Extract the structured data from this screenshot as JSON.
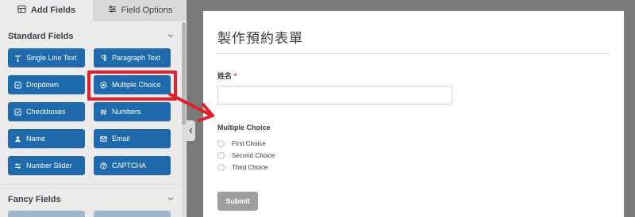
{
  "tabs": [
    {
      "label": "Add Fields",
      "icon": "list-icon",
      "active": true
    },
    {
      "label": "Field Options",
      "icon": "sliders-icon",
      "active": false
    }
  ],
  "sections": {
    "standard": {
      "title": "Standard Fields",
      "expanded": true
    },
    "fancy": {
      "title": "Fancy Fields",
      "expanded": true
    }
  },
  "fields": [
    {
      "label": "Single Line Text",
      "icon": "text-field-icon"
    },
    {
      "label": "Paragraph Text",
      "icon": "paragraph-icon"
    },
    {
      "label": "Dropdown",
      "icon": "dropdown-icon"
    },
    {
      "label": "Multiple Choice",
      "icon": "radio-icon"
    },
    {
      "label": "Checkboxes",
      "icon": "checkbox-icon"
    },
    {
      "label": "Numbers",
      "icon": "hash-icon"
    },
    {
      "label": "Name",
      "icon": "user-icon"
    },
    {
      "label": "Email",
      "icon": "envelope-icon"
    },
    {
      "label": "Number Slider",
      "icon": "slider-icon"
    },
    {
      "label": "CAPTCHA",
      "icon": "question-icon"
    }
  ],
  "colors": {
    "button_blue": "#1e6aac",
    "highlight_red": "#e3202b",
    "required_red": "#d63638",
    "submit_gray": "#9e9e9e"
  },
  "form": {
    "title": "製作預約表單",
    "name_label": "姓名",
    "required_mark": "*",
    "mc_label": "Multiple Choice",
    "choices": [
      "First Choice",
      "Second Choice",
      "Third Choice"
    ],
    "submit_label": "Submit"
  }
}
